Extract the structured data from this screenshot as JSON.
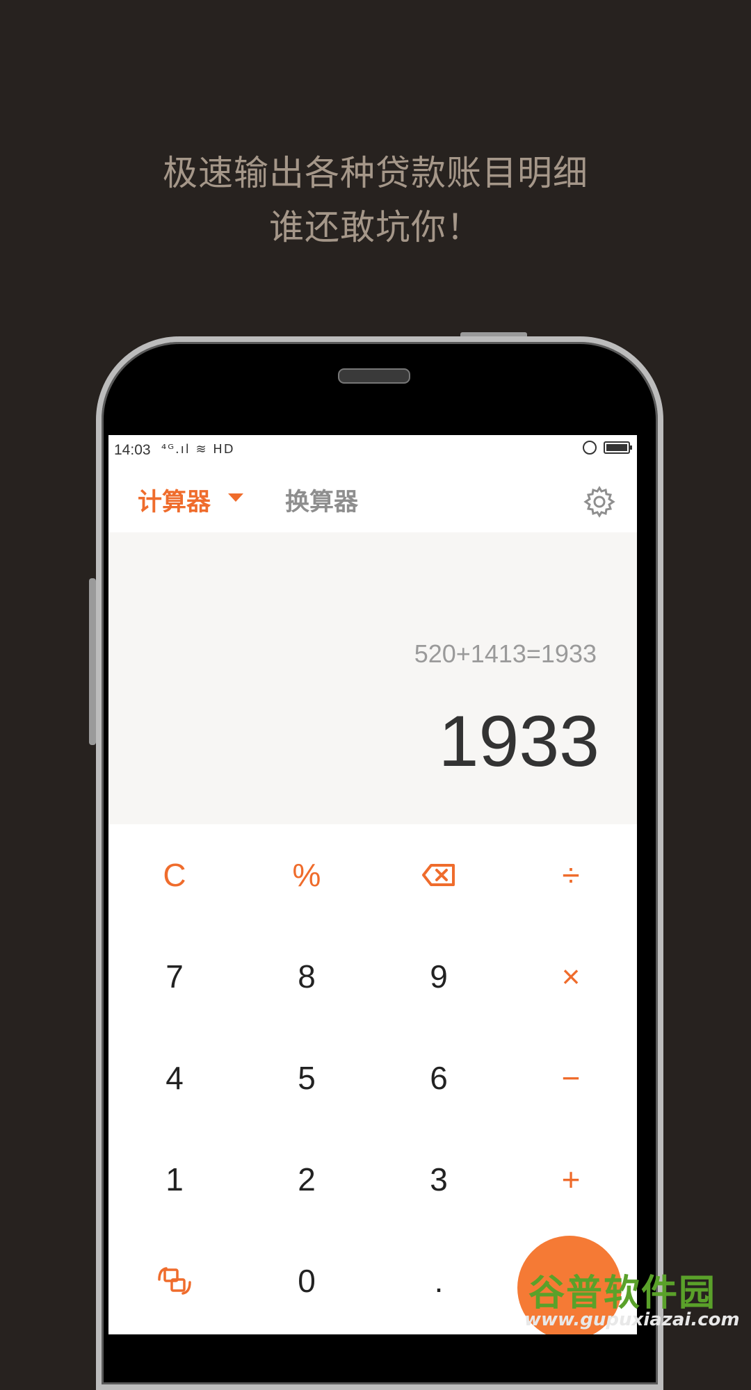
{
  "promo": {
    "line1": "极速输出各种贷款账目明细",
    "line2": "谁还敢坑你！"
  },
  "status": {
    "time": "14:03",
    "icons": "⁴ᴳ.ıl ≋ HD"
  },
  "tabs": {
    "calculator": "计算器",
    "converter": "换算器"
  },
  "display": {
    "expression": "520+1413=1933",
    "result": "1933"
  },
  "keys": {
    "clear": "C",
    "percent": "%",
    "divide": "÷",
    "multiply": "×",
    "minus": "−",
    "plus": "+",
    "k7": "7",
    "k8": "8",
    "k9": "9",
    "k4": "4",
    "k5": "5",
    "k6": "6",
    "k1": "1",
    "k2": "2",
    "k3": "3",
    "k0": "0",
    "dot": "."
  },
  "colors": {
    "accent": "#ef6c2c",
    "background": "#27221f",
    "display_bg": "#f7f6f4"
  },
  "watermark": {
    "title": "谷普软件园",
    "url": "www.gupuxiazai.com"
  }
}
